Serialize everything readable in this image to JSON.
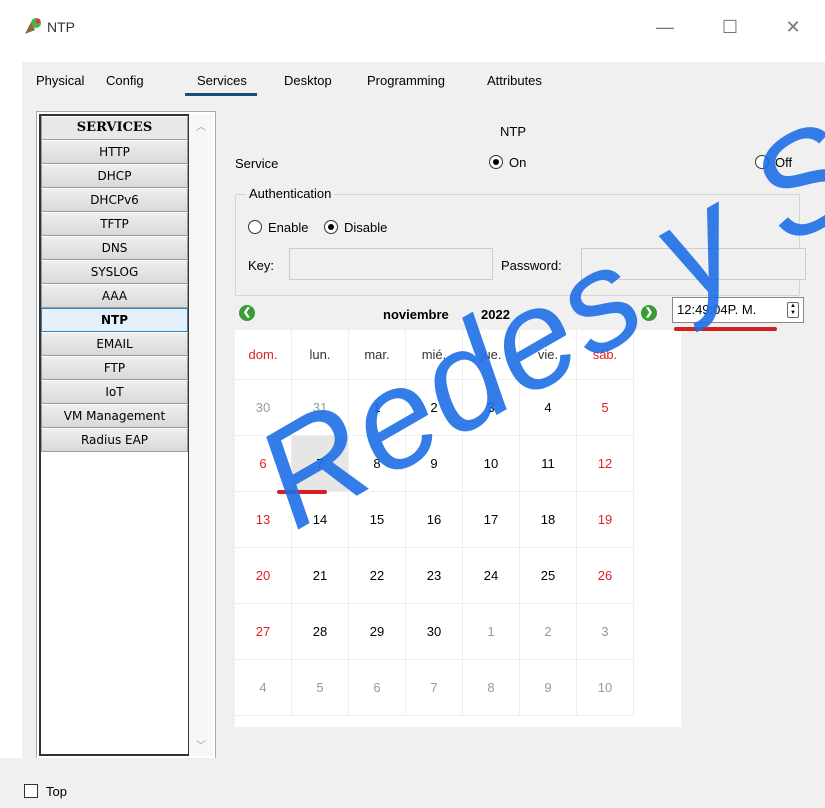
{
  "window": {
    "title": "NTP",
    "min": "—",
    "max": "☐",
    "close": "✕"
  },
  "tabs": [
    {
      "label": "Physical"
    },
    {
      "label": "Config"
    },
    {
      "label": "Services"
    },
    {
      "label": "Desktop"
    },
    {
      "label": "Programming"
    },
    {
      "label": "Attributes"
    }
  ],
  "services": {
    "header": "SERVICES",
    "items": [
      "HTTP",
      "DHCP",
      "DHCPv6",
      "TFTP",
      "DNS",
      "SYSLOG",
      "AAA",
      "NTP",
      "EMAIL",
      "FTP",
      "IoT",
      "VM Management",
      "Radius EAP"
    ],
    "selected": "NTP"
  },
  "ntp": {
    "title": "NTP",
    "service_label": "Service",
    "on_label": "On",
    "off_label": "Off",
    "auth_legend": "Authentication",
    "enable_label": "Enable",
    "disable_label": "Disable",
    "key_label": "Key:",
    "key_value": "",
    "password_label": "Password:",
    "password_value": "",
    "time": "12:49:04P. M."
  },
  "calendar": {
    "month": "noviembre",
    "year": "2022",
    "weekdays": [
      "dom.",
      "lun.",
      "mar.",
      "mié.",
      "jue.",
      "vie.",
      "sáb."
    ],
    "weeks": [
      [
        "30",
        "31",
        "1",
        "2",
        "3",
        "4",
        "5"
      ],
      [
        "6",
        "7",
        "8",
        "9",
        "10",
        "11",
        "12"
      ],
      [
        "13",
        "14",
        "15",
        "16",
        "17",
        "18",
        "19"
      ],
      [
        "20",
        "21",
        "22",
        "23",
        "24",
        "25",
        "26"
      ],
      [
        "27",
        "28",
        "29",
        "30",
        "1",
        "2",
        "3"
      ],
      [
        "4",
        "5",
        "6",
        "7",
        "8",
        "9",
        "10"
      ]
    ],
    "selected_day": "7"
  },
  "footer": {
    "top_label": "Top"
  },
  "watermark": "Redes y Seguridad"
}
